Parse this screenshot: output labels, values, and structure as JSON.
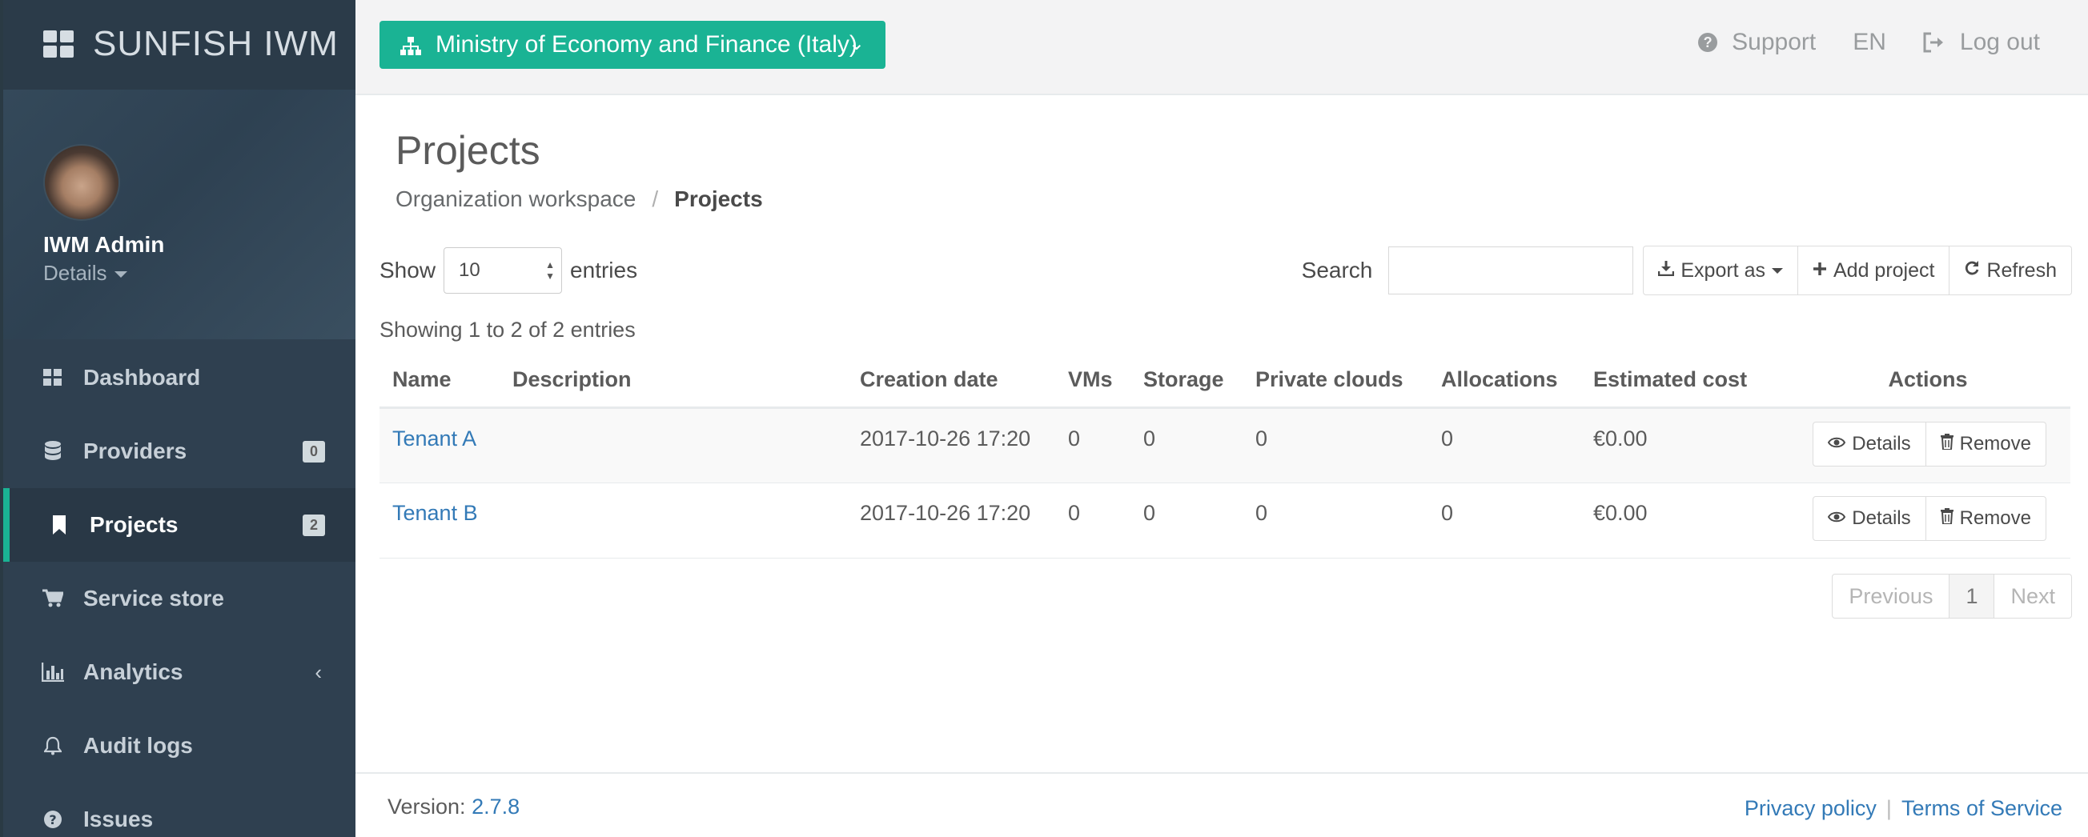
{
  "app": {
    "title": "SUNFISH IWM"
  },
  "profile": {
    "name": "IWM Admin",
    "details_label": "Details"
  },
  "sidebar": {
    "items": [
      {
        "label": "Dashboard",
        "icon": "dashboard-icon",
        "badge": ""
      },
      {
        "label": "Providers",
        "icon": "database-icon",
        "badge": "0"
      },
      {
        "label": "Projects",
        "icon": "bookmark-icon",
        "badge": "2",
        "active": true
      },
      {
        "label": "Service store",
        "icon": "cart-icon",
        "badge": ""
      },
      {
        "label": "Analytics",
        "icon": "bar-chart-icon",
        "badge": "",
        "chevron": "‹"
      },
      {
        "label": "Audit logs",
        "icon": "bell-icon",
        "badge": ""
      },
      {
        "label": "Issues",
        "icon": "question-icon",
        "badge": ""
      }
    ]
  },
  "topbar": {
    "organization": "Ministry of Economy and Finance (Italy)",
    "support": "Support",
    "language": "EN",
    "logout": "Log out"
  },
  "page": {
    "title": "Projects",
    "breadcrumb": [
      "Organization workspace",
      "Projects"
    ]
  },
  "table_controls": {
    "show_label": "Show",
    "entries_value": "10",
    "entries_label": "entries",
    "search_label": "Search",
    "search_value": "",
    "export_label": "Export as",
    "add_label": "Add project",
    "refresh_label": "Refresh",
    "info": "Showing 1 to 2 of 2 entries"
  },
  "table": {
    "columns": [
      "Name",
      "Description",
      "Creation date",
      "VMs",
      "Storage",
      "Private clouds",
      "Allocations",
      "Estimated cost",
      "Actions"
    ],
    "rows": [
      {
        "name": "Tenant A",
        "description": "",
        "creation_date": "2017-10-26 17:20",
        "vms": "0",
        "storage": "0",
        "private_clouds": "0",
        "allocations": "0",
        "estimated_cost": "€0.00"
      },
      {
        "name": "Tenant B",
        "description": "",
        "creation_date": "2017-10-26 17:20",
        "vms": "0",
        "storage": "0",
        "private_clouds": "0",
        "allocations": "0",
        "estimated_cost": "€0.00"
      }
    ],
    "details_label": "Details",
    "remove_label": "Remove"
  },
  "pagination": {
    "previous": "Previous",
    "page": "1",
    "next": "Next"
  },
  "footer": {
    "version_label": "Version:",
    "version": "2.7.8",
    "privacy": "Privacy policy",
    "separator": "|",
    "terms": "Terms of Service"
  },
  "colors": {
    "accent": "#1ab394",
    "sidebar": "#2f4050",
    "link": "#337ab7"
  }
}
